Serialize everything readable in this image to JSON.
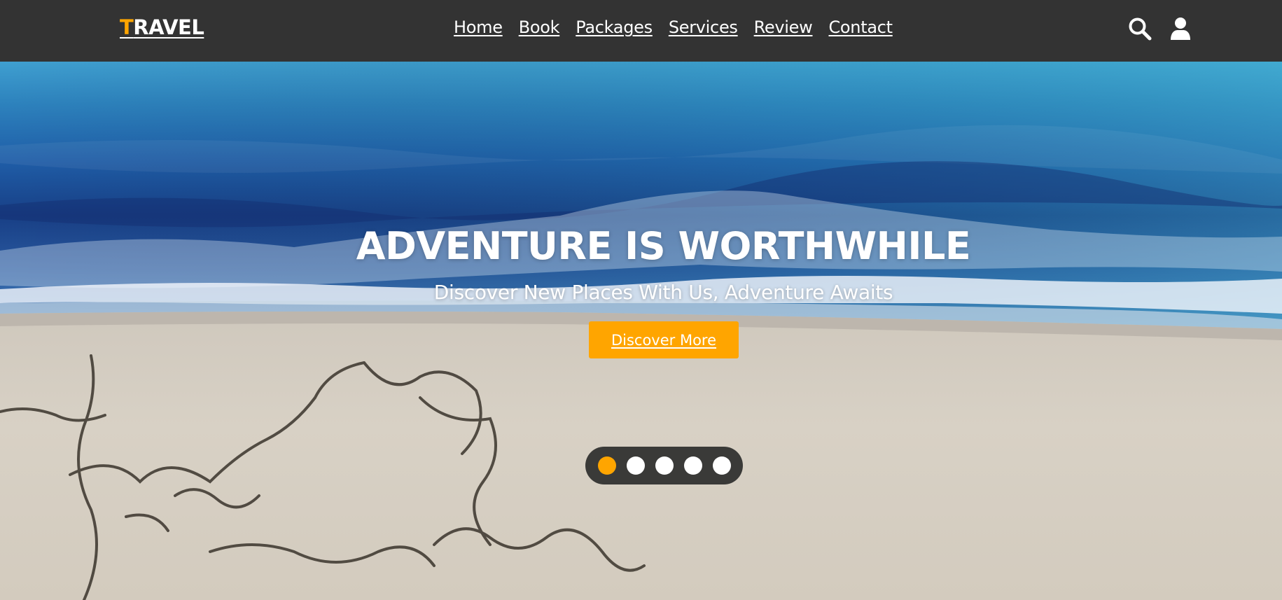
{
  "header": {
    "logo_first": "T",
    "logo_rest": "RAVEL",
    "nav": [
      "Home",
      "Book",
      "Packages",
      "Services",
      "Review",
      "Contact"
    ]
  },
  "icons": {
    "search": "search-icon",
    "user": "user-icon"
  },
  "hero": {
    "title": "ADVENTURE IS WORTHWHILE",
    "subtitle": "Discover New Places With Us, Adventure Awaits",
    "button": "Discover More"
  },
  "slider": {
    "count": 5,
    "active_index": 0
  },
  "colors": {
    "header_bg": "#333333",
    "accent": "#ffa500",
    "dots_bg": "#3a3a38"
  }
}
